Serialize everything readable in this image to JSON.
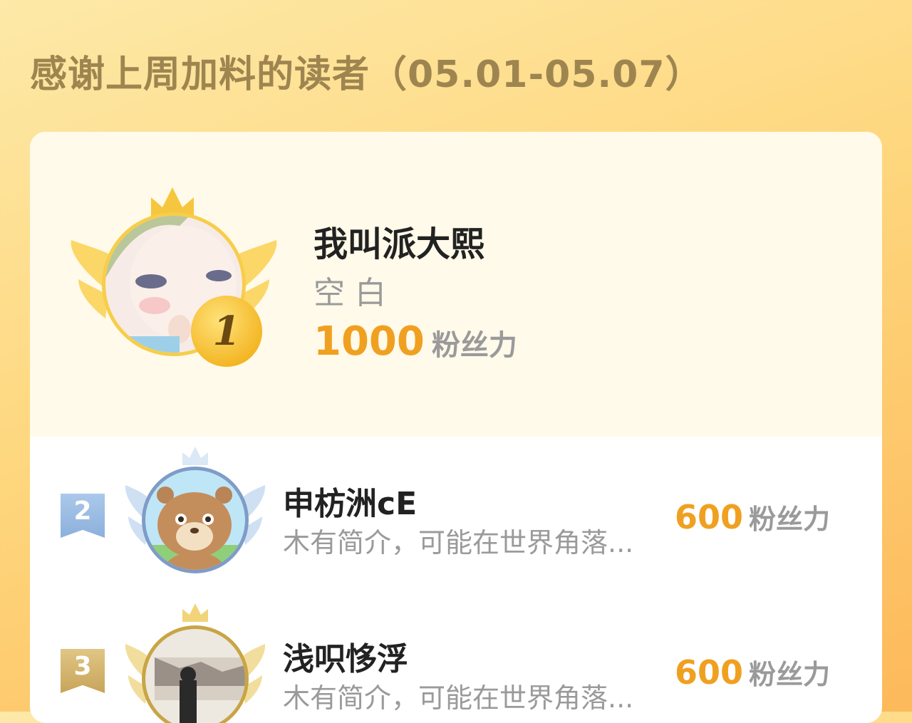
{
  "header": {
    "title": "感谢上周加料的读者（05.01-05.07）"
  },
  "first_place": {
    "rank": "1",
    "name": "我叫派大熙",
    "bio": "空白",
    "score": "1000",
    "unit": "粉丝力"
  },
  "ranks": [
    {
      "rank": "2",
      "name": "申枋洲cE",
      "bio": "木有简介，可能在世界角落...",
      "score": "600",
      "unit": "粉丝力"
    },
    {
      "rank": "3",
      "name": "浅呮恀浮",
      "bio": "木有简介，可能在世界角落...",
      "score": "600",
      "unit": "粉丝力"
    }
  ],
  "colors": {
    "accent": "#f0a020",
    "title": "#9e8550",
    "gold": "#f6c63e",
    "silver_blue": "#a9c8ea",
    "bronze": "#d6b870"
  }
}
